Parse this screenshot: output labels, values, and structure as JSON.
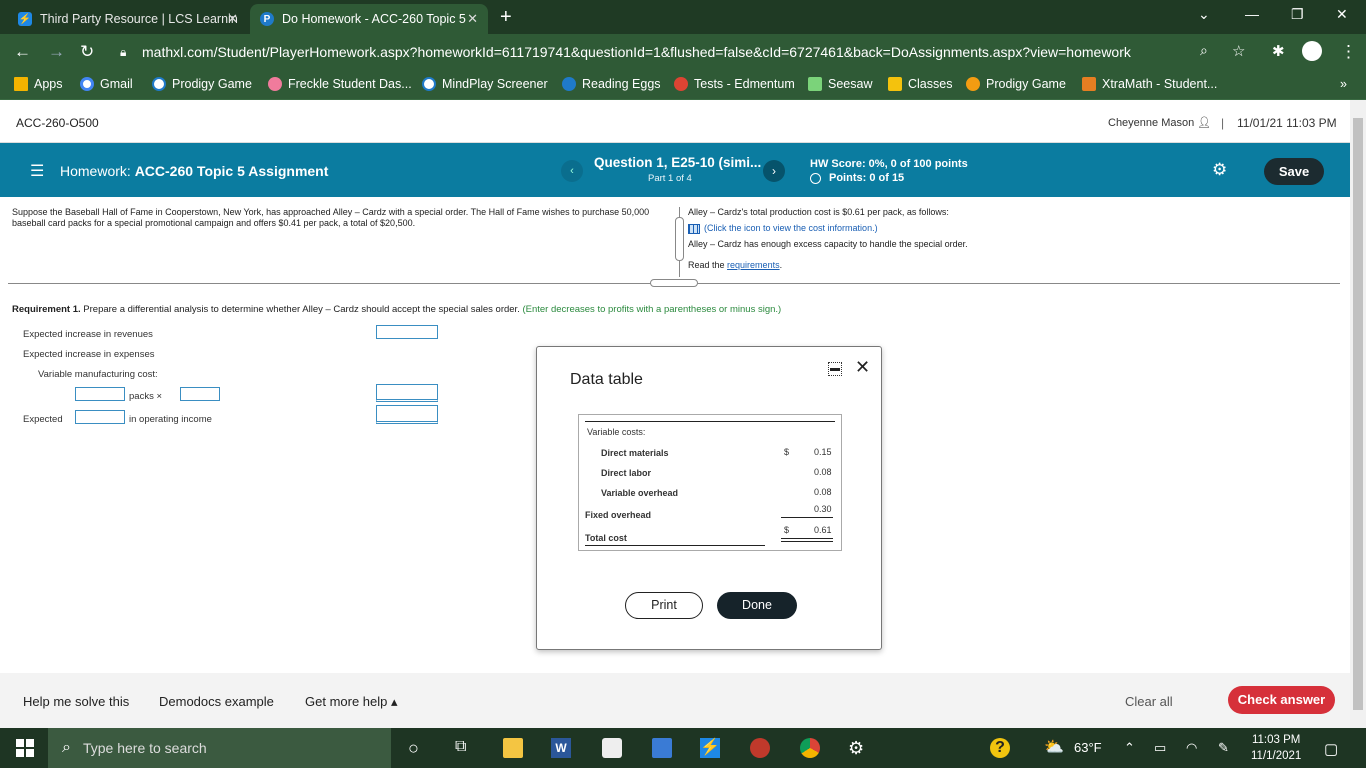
{
  "browser": {
    "tabs": [
      {
        "title": "Third Party Resource | LCS Learnin",
        "active": false
      },
      {
        "title": "Do Homework - ACC-260 Topic 5",
        "active": true
      }
    ],
    "url": "mathxl.com/Student/PlayerHomework.aspx?homeworkId=611719741&questionId=1&flushed=false&cId=6727461&back=DoAssignments.aspx?view=homework",
    "bookmarks": [
      "Apps",
      "Gmail",
      "Prodigy Game",
      "Freckle Student Das...",
      "MindPlay Screener",
      "Reading Eggs",
      "Tests - Edmentum",
      "Seesaw",
      "Classes",
      "Prodigy Game",
      "XtraMath - Student..."
    ],
    "bookmarks_more": "»"
  },
  "course": {
    "id": "ACC-260-O500",
    "user": "Cheyenne Mason",
    "separator": "|",
    "datetime": "11/01/21 11:03 PM"
  },
  "header": {
    "hw_prefix": "Homework:",
    "hw_title": "ACC-260 Topic 5 Assignment",
    "question_title": "Question 1, E25-10 (simi...",
    "question_part": "Part 1 of 4",
    "hw_score": "HW Score: 0%, 0 of 100 points",
    "points": "Points: 0 of 15",
    "save_label": "Save"
  },
  "problem": {
    "text": "Suppose the Baseball Hall of Fame in Cooperstown, New York, has approached Alley – Cardz with a special order. The Hall of Fame wishes to purchase 50,000 baseball card packs for a special promotional campaign and offers $0.41 per pack, a total of $20,500.",
    "cost_line": "Alley – Cardz's total production cost is $0.61 per pack, as follows:",
    "click_icon": "(Click the icon to view the cost information.)",
    "capacity": "Alley – Cardz has enough excess capacity to handle the special order.",
    "read_prefix": "Read the",
    "requirements_link": "requirements",
    "read_suffix": "."
  },
  "requirement": {
    "label": "Requirement 1.",
    "text": "Prepare a differential analysis to determine whether Alley – Cardz should accept the special sales order.",
    "hint": "(Enter decreases to profits with a parentheses or minus sign.)",
    "rows": {
      "revenues": "Expected increase in revenues",
      "expenses": "Expected increase in expenses",
      "variable_cost": "Variable manufacturing cost:",
      "packs": "packs ×",
      "expected": "Expected",
      "operating_income": "in operating income"
    }
  },
  "modal": {
    "title": "Data table",
    "header": "Variable costs:",
    "rows": [
      {
        "label": "Direct materials",
        "dollar": "$",
        "value": "0.15"
      },
      {
        "label": "Direct labor",
        "dollar": "",
        "value": "0.08"
      },
      {
        "label": "Variable overhead",
        "dollar": "",
        "value": "0.08"
      }
    ],
    "subtotal": "0.30",
    "fixed_label": "Fixed overhead",
    "total_dollar": "$",
    "total_value": "0.61",
    "total_label": "Total cost",
    "print_label": "Print",
    "done_label": "Done"
  },
  "footer": {
    "help": "Help me solve this",
    "demodocs": "Demodocs example",
    "more_help": "Get more help ▴",
    "clear_all": "Clear all",
    "check_answer": "Check answer"
  },
  "taskbar": {
    "search_placeholder": "Type here to search",
    "weather": "63°F",
    "time": "11:03 PM",
    "date": "11/1/2021"
  },
  "colors": {
    "header_teal": "#0b7ca0",
    "check_red": "#d6303a",
    "chrome_green": "#2f5a36",
    "link_blue": "#1a5fb4"
  }
}
